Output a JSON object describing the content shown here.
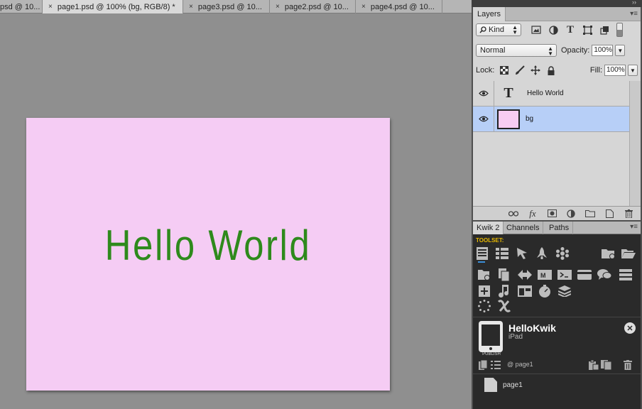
{
  "doc_tabs": [
    {
      "label": "psd @ 10...",
      "active": false
    },
    {
      "label": "page1.psd @ 100% (bg, RGB/8) *",
      "active": true
    },
    {
      "label": "page3.psd @ 10...",
      "active": false
    },
    {
      "label": "page2.psd @ 10...",
      "active": false
    },
    {
      "label": "page4.psd @ 10...",
      "active": false
    }
  ],
  "tab_close_glyph": "×",
  "artboard": {
    "background": "#f5ccf4",
    "text": "Hello World",
    "text_color": "#2e8a1c"
  },
  "layers_panel": {
    "tab_label": "Layers",
    "menu_glyph": "▾≡",
    "filter": {
      "kind_label": "Kind",
      "icons": [
        "image-filter-icon",
        "adjustment-filter-icon",
        "type-filter-icon",
        "shape-filter-icon",
        "smart-object-filter-icon"
      ]
    },
    "blend_mode": "Normal",
    "opacity_label": "Opacity:",
    "opacity_value": "100%",
    "lock_label": "Lock:",
    "fill_label": "Fill:",
    "fill_value": "100%",
    "layers": [
      {
        "name": "Hello World",
        "type": "text",
        "thumb_glyph": "T",
        "visible": true,
        "selected": false
      },
      {
        "name": "bg",
        "type": "pixel",
        "visible": true,
        "selected": true
      }
    ],
    "footer_icons": [
      "link-layers-icon",
      "fx-icon",
      "add-mask-icon",
      "adjustment-layer-icon",
      "new-group-icon",
      "new-layer-icon",
      "delete-layer-icon"
    ],
    "fx_label": "fx"
  },
  "kwik_panel": {
    "tabs": [
      {
        "label": "Kwik 2",
        "active": true
      },
      {
        "label": "Channels",
        "active": false
      },
      {
        "label": "Paths",
        "active": false
      }
    ],
    "toolset_label": "TOOLSET:",
    "project_name": "HelloKwik",
    "device": "iPad",
    "publish_label": "PUBLISH",
    "page_ref": "@ page1",
    "pages": [
      "page1"
    ]
  }
}
